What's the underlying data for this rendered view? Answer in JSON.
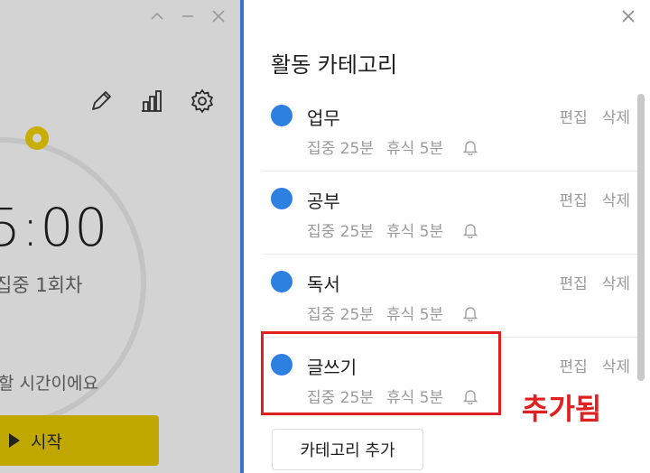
{
  "timer": {
    "time": "5:00",
    "session": "집중 1회차",
    "hint": "할 시간이에요",
    "start_label": "시작"
  },
  "panel": {
    "title": "활동 카테고리",
    "add_button": "카테고리 추가",
    "edit_label": "편집",
    "delete_label": "삭제"
  },
  "categories": [
    {
      "name": "업무",
      "focus": "집중 25분",
      "rest": "휴식 5분"
    },
    {
      "name": "공부",
      "focus": "집중 25분",
      "rest": "휴식 5분"
    },
    {
      "name": "독서",
      "focus": "집중 25분",
      "rest": "휴식 5분"
    },
    {
      "name": "글쓰기",
      "focus": "집중 25분",
      "rest": "휴식 5분"
    }
  ],
  "annotation": {
    "label": "추가됨"
  },
  "colors": {
    "accent_blue": "#2d7fe0",
    "start_yellow": "#c1a800",
    "annotation_red": "#e02020"
  }
}
